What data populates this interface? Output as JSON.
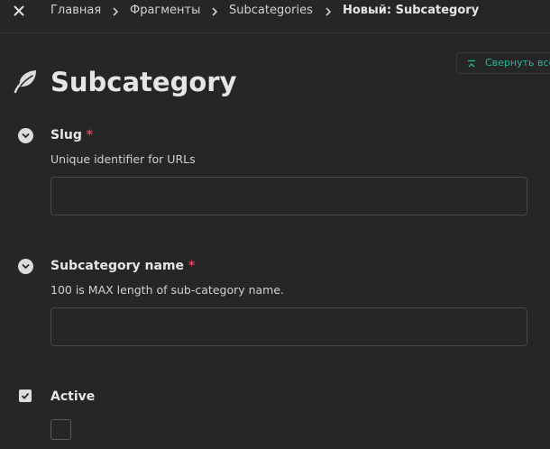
{
  "breadcrumbs": {
    "items": [
      {
        "label": "Главная"
      },
      {
        "label": "Фрагменты"
      },
      {
        "label": "Subcategories"
      }
    ],
    "current": "Новый: Subcategory"
  },
  "actions": {
    "collapse_label": "Свернуть все"
  },
  "header": {
    "title": "Subcategory",
    "icon": "leaf-icon"
  },
  "fields": {
    "slug": {
      "label": "Slug",
      "required_mark": "*",
      "help": "Unique identifier for URLs",
      "value": "",
      "placeholder": ""
    },
    "name": {
      "label": "Subcategory name",
      "required_mark": "*",
      "help": "100 is MAX length of sub-category name.",
      "value": "",
      "placeholder": ""
    },
    "active": {
      "label": "Active",
      "checked": false
    }
  },
  "colors": {
    "background": "#262626",
    "accent": "#29b59a",
    "required": "#e0445a"
  }
}
